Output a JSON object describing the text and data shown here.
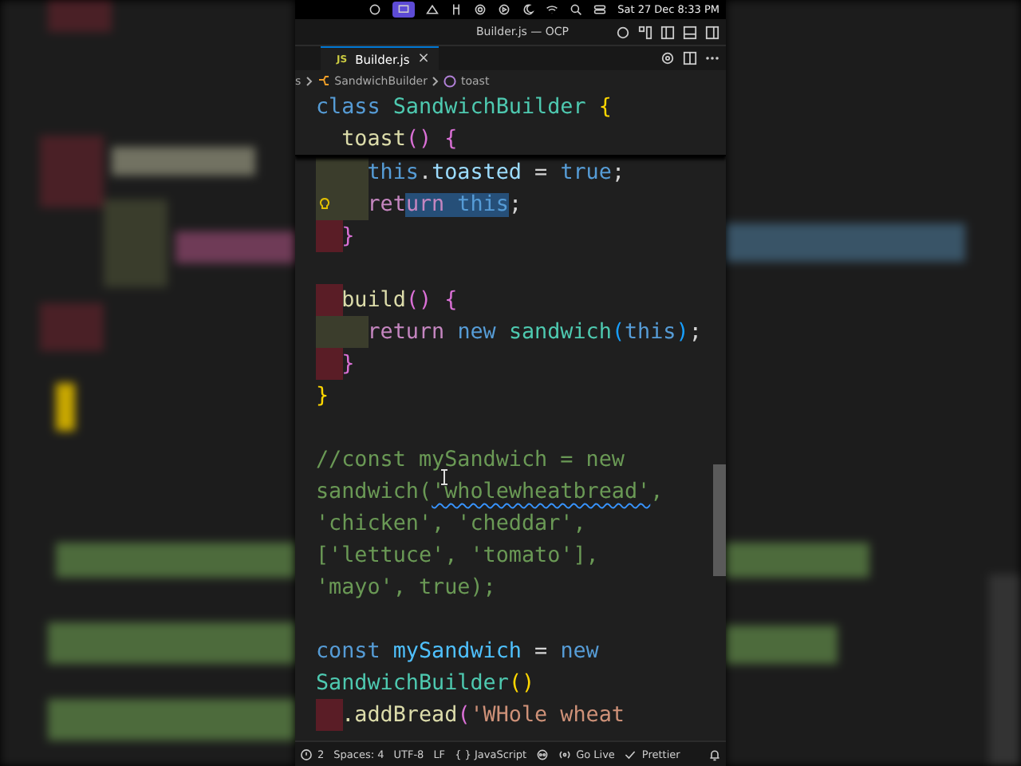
{
  "menu_bar": {
    "clock": "Sat 27 Dec 8:33 PM"
  },
  "window": {
    "title": "Builder.js — OCP"
  },
  "tabs": [
    {
      "icon_text": "JS",
      "label": "Builder.js",
      "close": "×",
      "selected": true
    }
  ],
  "breadcrumbs": [
    "s",
    "SandwichBuilder",
    "toast"
  ],
  "sticky_lines": [
    {
      "tokens": [
        {
          "text": "class ",
          "kind": "keyword"
        },
        {
          "text": "SandwichBuilder ",
          "kind": "class"
        },
        {
          "text": "{",
          "kind": "bracket1"
        }
      ]
    },
    {
      "tokens": [
        {
          "text": "  toast",
          "kind": "fn"
        },
        {
          "text": "() {",
          "kind": "bracket2"
        }
      ]
    }
  ],
  "lines": [
    {
      "kind": "changed",
      "hint": false,
      "tokens": [
        {
          "text": "    this",
          "kind": "keyword"
        },
        {
          "text": ".",
          "kind": "plain"
        },
        {
          "text": "toasted",
          "kind": "var"
        },
        {
          "text": " = ",
          "kind": "plain"
        },
        {
          "text": "true",
          "kind": "keyword"
        },
        {
          "text": ";",
          "kind": "plain"
        }
      ]
    },
    {
      "kind": "changed",
      "hint": true,
      "tokens": [
        {
          "text": "    ret",
          "kind": "control",
          "selected": false
        },
        {
          "text": "urn",
          "kind": "control",
          "selected": true
        },
        {
          "text": " this",
          "kind": "keyword",
          "selected": true
        },
        {
          "text": ";",
          "kind": "plain",
          "selected": false
        }
      ]
    },
    {
      "kind": "removed",
      "hint": false,
      "tokens": [
        {
          "text": "  }",
          "kind": "bracket2"
        }
      ]
    },
    {
      "kind": "plain",
      "hint": false
    },
    {
      "kind": "removed",
      "hint": false,
      "tokens": [
        {
          "text": "  build",
          "kind": "fn"
        },
        {
          "text": "() {",
          "kind": "bracket2"
        }
      ]
    },
    {
      "kind": "changed",
      "hint": false,
      "tokens": [
        {
          "text": "    return ",
          "kind": "control"
        },
        {
          "text": "new ",
          "kind": "keyword"
        },
        {
          "text": "sandwich",
          "kind": "class"
        },
        {
          "text": "(",
          "kind": "bracket3"
        },
        {
          "text": "this",
          "kind": "keyword"
        },
        {
          "text": ")",
          "kind": "bracket3"
        },
        {
          "text": ";",
          "kind": "plain"
        }
      ]
    },
    {
      "kind": "removed",
      "hint": false,
      "tokens": [
        {
          "text": "  }",
          "kind": "bracket2"
        }
      ]
    },
    {
      "kind": "plain",
      "hint": false,
      "tokens": [
        {
          "text": "}",
          "kind": "bracket1"
        }
      ]
    },
    {
      "kind": "plain",
      "hint": false
    },
    {
      "kind": "plain",
      "hint": false,
      "tokens": [
        {
          "text": "//const mySandwich = new",
          "kind": "comment"
        }
      ]
    },
    {
      "kind": "plain",
      "hint": false,
      "tokens": [
        {
          "text": "sandwich(",
          "kind": "comment",
          "misspelled": false
        },
        {
          "text": "'wholewheatbread'",
          "kind": "comment",
          "misspelled": true
        },
        {
          "text": ",",
          "kind": "comment",
          "misspelled": false
        }
      ]
    },
    {
      "kind": "plain",
      "hint": false,
      "tokens": [
        {
          "text": "'chicken', 'cheddar',",
          "kind": "comment"
        }
      ]
    },
    {
      "kind": "plain",
      "hint": false,
      "tokens": [
        {
          "text": "['lettuce', 'tomato'],",
          "kind": "comment"
        }
      ]
    },
    {
      "kind": "plain",
      "hint": false,
      "tokens": [
        {
          "text": "'mayo', true);",
          "kind": "comment"
        }
      ]
    },
    {
      "kind": "plain",
      "hint": false
    },
    {
      "kind": "plain",
      "hint": false,
      "tokens": [
        {
          "text": "const ",
          "kind": "keyword"
        },
        {
          "text": "mySandwich",
          "kind": "const"
        },
        {
          "text": " = ",
          "kind": "plain"
        },
        {
          "text": "new",
          "kind": "keyword"
        }
      ]
    },
    {
      "kind": "plain",
      "hint": false,
      "tokens": [
        {
          "text": "SandwichBuilder",
          "kind": "class"
        },
        {
          "text": "()",
          "kind": "bracket1"
        }
      ]
    },
    {
      "kind": "removed",
      "hint": false,
      "tokens": [
        {
          "text": "  .addBread",
          "kind": "fn"
        },
        {
          "text": "(",
          "kind": "bracket2"
        },
        {
          "text": "'WHole wheat",
          "kind": "string"
        }
      ]
    }
  ],
  "status_bar": [
    {
      "kind": "problems",
      "text": "2"
    },
    {
      "kind": "text",
      "text": "Spaces: 4"
    },
    {
      "kind": "text",
      "text": "UTF-8"
    },
    {
      "kind": "text",
      "text": "LF"
    },
    {
      "kind": "text",
      "text": "{ } JavaScript"
    },
    {
      "kind": "copilot"
    },
    {
      "kind": "live",
      "text": "Go Live"
    },
    {
      "kind": "check",
      "text": "Prettier"
    },
    {
      "kind": "bell"
    }
  ]
}
